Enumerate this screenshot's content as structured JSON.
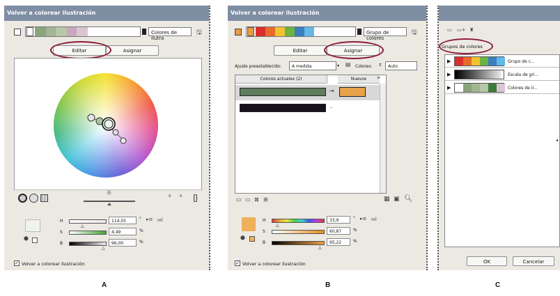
{
  "panel_a": {
    "title": "Volver a colorear ilustración",
    "group_dropdown": "Colores de ilutra",
    "tabs": [
      "Editar",
      "Asignar"
    ],
    "h_label": "H",
    "s_label": "S",
    "b_label": "B",
    "h_value": "114,55",
    "s_value": "4,49",
    "b_value": "96,00",
    "deg": "°",
    "pct1": "%",
    "pct2": "%",
    "recolor_label": "Volver a colorear ilustración"
  },
  "panel_b": {
    "title": "Volver a colorear ilustración",
    "group_dropdown": "Grupo de colores",
    "tabs": [
      "Editar",
      "Asignar"
    ],
    "preset_label": "Ajuste preestablecido:",
    "preset_value": "A medida",
    "colors_label": "Colores:",
    "colors_value": "Auto",
    "col_current": "Colores actuales (2)",
    "col_new": "Nuevos",
    "dash": "–",
    "h_label": "H",
    "s_label": "S",
    "b_label": "B",
    "h_value": "33,9",
    "s_value": "60,87",
    "b_value": "95,22",
    "deg": "°",
    "pct1": "%",
    "pct2": "%",
    "recolor_label": "Volver a colorear ilustración"
  },
  "panel_c": {
    "tab": "Grupos de colores",
    "groups": [
      "Grupo de c...",
      "Escala de gri...",
      "Colores de il..."
    ],
    "ok": "OK",
    "cancel": "Cancelar"
  },
  "captions": {
    "a": "A",
    "b": "B",
    "c": "C"
  },
  "colors": {
    "highlight_oval": "#8b1a3a",
    "title_bar": "#7e8ea3",
    "orange_new": "#e8a34a"
  }
}
